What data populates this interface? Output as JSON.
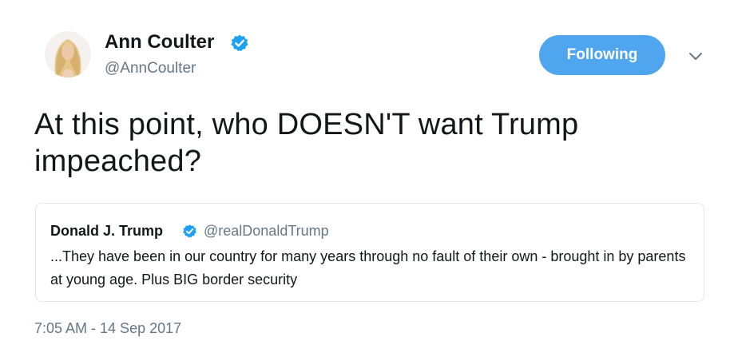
{
  "author": {
    "display_name": "Ann Coulter",
    "handle": "@AnnCoulter",
    "verified_icon": "verified-badge-icon",
    "avatar_icon": "profile-photo"
  },
  "follow_button": {
    "label": "Following"
  },
  "menu": {
    "icon": "chevron-down-icon"
  },
  "tweet": {
    "text": "At this point, who DOESN'T want Trump impeached?",
    "timestamp": "7:05 AM - 14 Sep 2017"
  },
  "quoted_tweet": {
    "display_name": "Donald J. Trump",
    "handle": "@realDonaldTrump",
    "text": "...They have been in our country for many years through no fault of their own - brought in by parents at young age. Plus BIG border security"
  },
  "colors": {
    "accent": "#4fa6ef",
    "secondary_text": "#657786",
    "verified": "#1da1f2",
    "border": "#e1e8ed"
  }
}
